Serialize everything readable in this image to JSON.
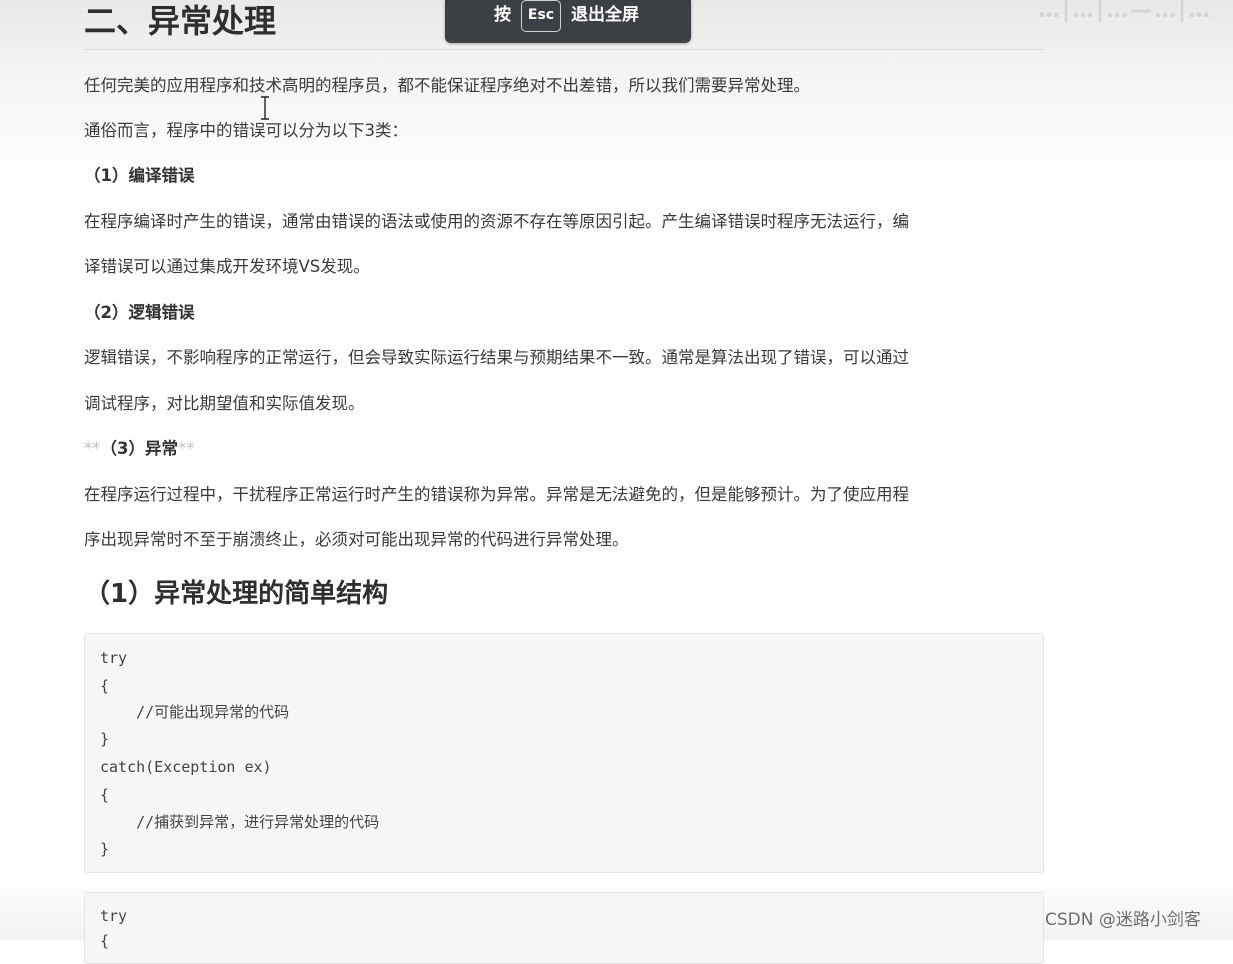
{
  "overlay": {
    "press_label": "按",
    "key_label": "Esc",
    "action_label": "退出全屏"
  },
  "corner_faded_text": "…|…|…—…|…",
  "article": {
    "heading": "二、异常处理",
    "intro": "任何完美的应用程序和技术高明的程序员，都不能保证程序绝对不出差错，所以我们需要异常处理。",
    "categories_intro": "通俗而言，程序中的错误可以分为以下3类：",
    "compile": {
      "title": "（1）编译错误",
      "line1": "在程序编译时产生的错误，通常由错误的语法或使用的资源不存在等原因引起。产生编译错误时程序无法运行，编",
      "line2": "译错误可以通过集成开发环境VS发现。"
    },
    "logic": {
      "title": "（2）逻辑错误",
      "line1": "逻辑错误，不影响程序的正常运行，但会导致实际运行结果与预期结果不一致。通常是算法出现了错误，可以通过",
      "line2": "调试程序，对比期望值和实际值发现。"
    },
    "exception": {
      "stars_open": "**",
      "title": "（3）异常",
      "stars_close": "**",
      "line1": "在程序运行过程中，干扰程序正常运行时产生的错误称为异常。异常是无法避免的，但是能够预计。为了使应用程",
      "line2": "序出现异常时不至于崩溃终止，必须对可能出现异常的代码进行异常处理。"
    },
    "subheading": "（1）异常处理的简单结构",
    "code_block_1": [
      "try",
      "{",
      "    //可能出现异常的代码",
      "}",
      "catch(Exception ex)",
      "{",
      "    //捕获到异常，进行异常处理的代码",
      "}"
    ],
    "code_block_2": [
      "try",
      "{"
    ]
  },
  "watermark": "CSDN @迷路小剑客"
}
